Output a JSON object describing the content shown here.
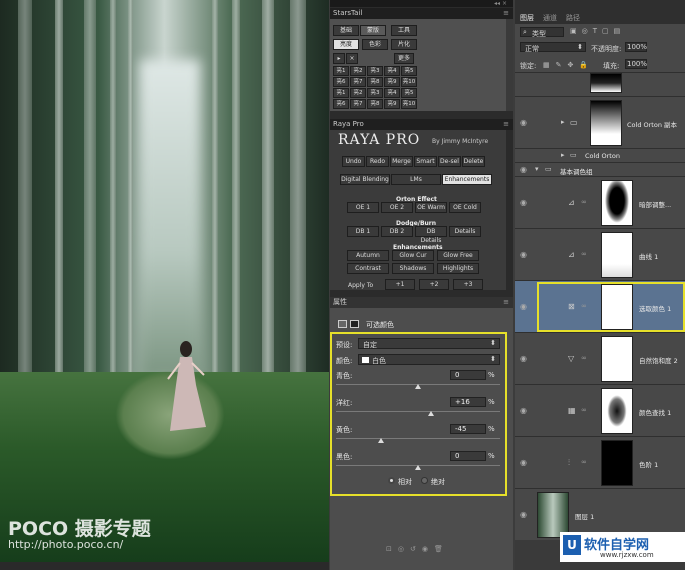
{
  "watermark": {
    "brand": "POCO 摄影专题",
    "url": "http://photo.poco.cn/"
  },
  "starstail": {
    "title": "StarsTail",
    "tabs": [
      "基础",
      "蒙版",
      "工具"
    ],
    "subtabs": [
      "亮度",
      "色彩",
      "片化"
    ],
    "more": "更多",
    "grid": [
      "亮1",
      "亮2",
      "亮3",
      "亮4",
      "亮5",
      "亮6",
      "亮7",
      "亮8",
      "亮9",
      "亮10",
      "亮1",
      "亮2",
      "亮3",
      "亮4",
      "亮5",
      "亮6",
      "亮7",
      "亮8",
      "亮9",
      "亮10"
    ]
  },
  "raya": {
    "title": "Raya Pro",
    "logo": "RAYA PRO",
    "by": "By Jimmy McIntyre",
    "top_buttons": [
      "Undo",
      "Redo",
      "Merge",
      "Smart",
      "De-sel",
      "Delete"
    ],
    "tabs": [
      "Digital Blending",
      "LMs",
      "Enhancements"
    ],
    "orton_title": "Orton Effect",
    "orton": [
      "OE 1",
      "OE 2",
      "OE Warm",
      "OE Cold"
    ],
    "dodge_title": "Dodge/Burn",
    "dodge": [
      "DB 1",
      "DB 2",
      "DB Details",
      "Details"
    ],
    "enh_title": "Enhancements",
    "enh1": [
      "Autumn",
      "Glow Cur",
      "Glow Free"
    ],
    "enh2": [
      "Contrast",
      "Shadows",
      "Highlights"
    ],
    "apply_to": "Apply To",
    "apply_btns": [
      "+1",
      "+2",
      "+3"
    ]
  },
  "properties": {
    "title": "属性",
    "heading": "可选颜色",
    "preset_label": "预设:",
    "preset_value": "自定",
    "color_label": "颜色:",
    "color_value": "白色",
    "sliders": [
      {
        "label": "青色:",
        "value": "0",
        "pos": 0.5
      },
      {
        "label": "洋红:",
        "value": "+16",
        "pos": 0.58
      },
      {
        "label": "黄色:",
        "value": "-45",
        "pos": 0.275
      },
      {
        "label": "黑色:",
        "value": "0",
        "pos": 0.5
      }
    ],
    "unit": "%",
    "relative": "相对",
    "absolute": "绝对"
  },
  "layers": {
    "tabs": [
      "图层",
      "通道",
      "路径"
    ],
    "kind_label": "类型",
    "blend_mode": "正常",
    "opacity_label": "不透明度:",
    "opacity": "100%",
    "lock_label": "锁定:",
    "fill_label": "填充:",
    "fill": "100%",
    "items": [
      {
        "name": "Cold Orton 副本",
        "type": "group"
      },
      {
        "name": "Cold Orton",
        "type": "group"
      },
      {
        "name": "基本调色组",
        "type": "folder"
      },
      {
        "name": "暗部调整...",
        "type": "curves-mask"
      },
      {
        "name": "曲线 1",
        "type": "curves"
      },
      {
        "name": "选取颜色 1",
        "type": "selective",
        "selected": true
      },
      {
        "name": "自然饱和度 2",
        "type": "vibrance"
      },
      {
        "name": "颜色查找 1",
        "type": "lookup"
      },
      {
        "name": "色阶 1",
        "type": "levels"
      },
      {
        "name": "图层 1",
        "type": "photo"
      }
    ]
  },
  "site_badge": {
    "text": "软件自学网",
    "url": "www.rjzxw.com"
  }
}
